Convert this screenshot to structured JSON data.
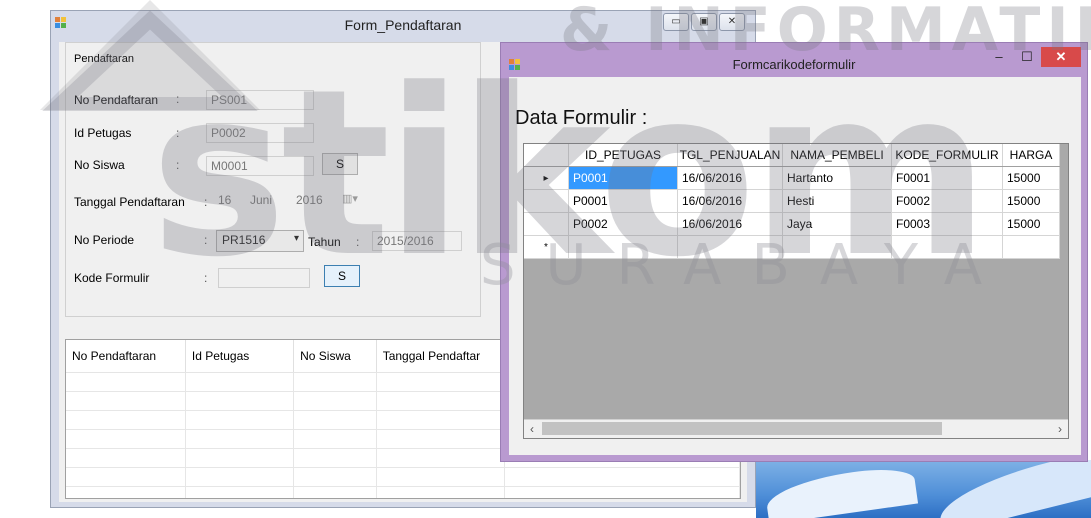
{
  "watermark": {
    "main": "stikom",
    "top": "& INFORMATIKA",
    "bottom": "SURABAYA"
  },
  "main_window": {
    "title": "Form_Pendaftaran",
    "group_caption": "Pendaftaran",
    "fields": {
      "no_pendaftaran": {
        "label": "No Pendaftaran",
        "colon": ":",
        "value": "PS001"
      },
      "id_petugas": {
        "label": "Id Petugas",
        "colon": ":",
        "value": "P0002"
      },
      "no_siswa": {
        "label": "No Siswa",
        "colon": ":",
        "value": "M0001",
        "button": "S"
      },
      "tanggal": {
        "label": "Tanggal Pendaftaran",
        "colon": ":",
        "day": "16",
        "month": "Juni",
        "year": "2016"
      },
      "no_periode": {
        "label": "No Periode",
        "colon": ":",
        "value": "PR1516",
        "tahun_label": "Tahun",
        "tahun_colon": ":",
        "tahun_value": "2015/2016"
      },
      "kode_formulir": {
        "label": "Kode Formulir",
        "colon": ":",
        "value": "",
        "button": "S"
      }
    },
    "grid_columns": [
      "No Pendaftaran",
      "Id Petugas",
      "No Siswa",
      "Tanggal Pendaftar"
    ]
  },
  "search_window": {
    "title": "Formcarikodeformulir",
    "heading": "Data  Formulir   :",
    "columns": [
      "ID_PETUGAS",
      "TGL_PENJUALAN",
      "NAMA_PEMBELI",
      "KODE_FORMULIR",
      "HARGA"
    ],
    "rows": [
      [
        "P0001",
        "16/06/2016",
        "Hartanto",
        "F0001",
        "15000"
      ],
      [
        "P0001",
        "16/06/2016",
        "Hesti",
        "F0002",
        "15000"
      ],
      [
        "P0002",
        "16/06/2016",
        "Jaya",
        "F0003",
        "15000"
      ]
    ],
    "new_row_marker": "*",
    "current_row_marker": "▸"
  },
  "colors": {
    "search_frame": "#b99ad0",
    "selection": "#3399ff",
    "close_button": "#d84a4a"
  }
}
